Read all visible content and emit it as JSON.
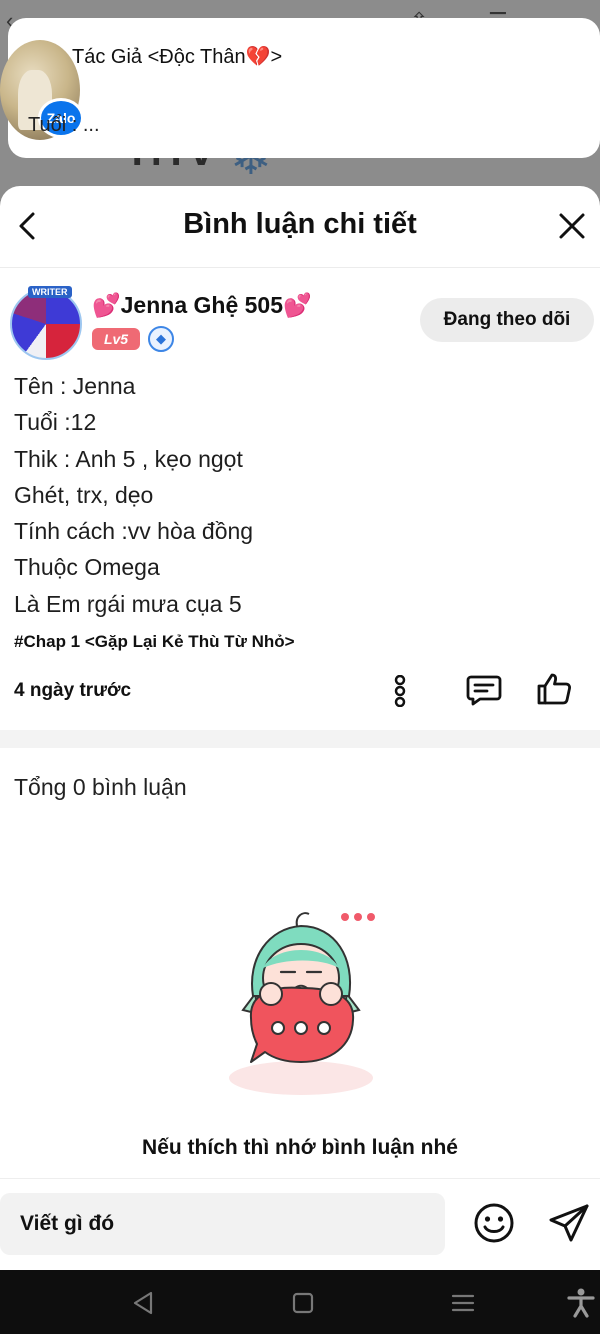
{
  "background": {
    "title_fragment": "TiTv"
  },
  "notification": {
    "app": "Zalo",
    "title": "Tác Giả <Độc Thân💔>",
    "body": "Tuổi : ..."
  },
  "sheet": {
    "title": "Bình luận chi tiết"
  },
  "author": {
    "name": "💕Jenna Ghệ 505💕",
    "level": "Lv5",
    "avatar_tag": "WRITER",
    "follow_label": "Đang theo dõi"
  },
  "post": {
    "lines": [
      "Tên : Jenna",
      "Tuổi :12",
      "Thik : Anh 5 , kẹo ngọt",
      "Ghét, trx, dẹo",
      "Tính cách :vv hòa đồng",
      "Thuộc Omega",
      "Là Em rgái mưa cụa 5"
    ],
    "chapter_tag": "#Chap 1 <Gặp Lại Kẻ Thù Từ Nhỏ>",
    "time": "4 ngày trước"
  },
  "comments": {
    "total_label": "Tổng 0 bình luận",
    "empty_message": "Nếu thích thì nhớ bình luận nhé"
  },
  "composer": {
    "placeholder": "Viết gì đó"
  },
  "colors": {
    "accent_pink": "#ef6a74",
    "verify_blue": "#3d86e6",
    "zalo_blue": "#0a74ec"
  }
}
